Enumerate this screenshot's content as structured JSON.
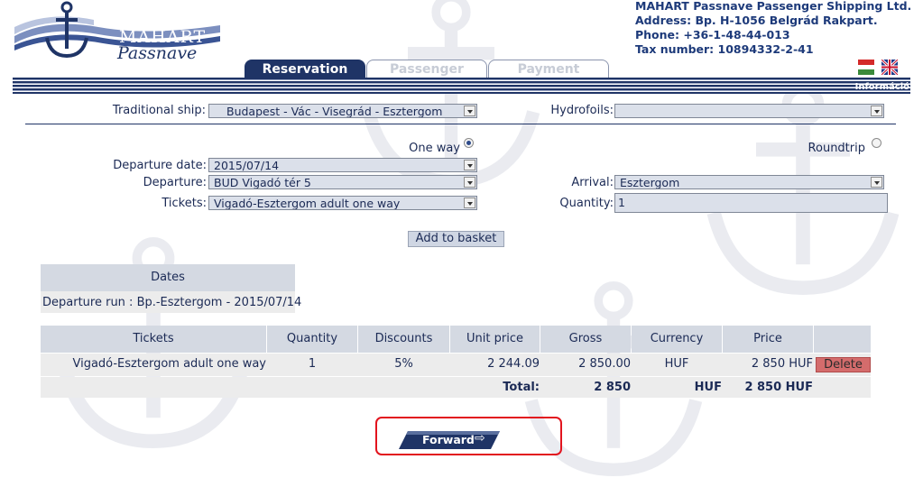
{
  "brand": {
    "logo_top": "MAHART",
    "logo_bottom": "Passnave"
  },
  "company": {
    "line1": "MAHART Passnave Passenger Shipping Ltd.",
    "line2": "Address: Bp. H-1056 Belgrád Rakpart.",
    "line3": "Phone: +36-1-48-44-013",
    "line4": "Tax number: 10894332-2-41"
  },
  "tabs": [
    {
      "label": "Reservation",
      "active": true
    },
    {
      "label": "Passenger",
      "active": false
    },
    {
      "label": "Payment",
      "active": false
    }
  ],
  "info_link": "Információ",
  "form": {
    "traditional_ship_label": "Traditional ship:",
    "traditional_ship_value": "Budapest - Vác - Visegrád - Esztergom",
    "hydrofoils_label": "Hydrofoils:",
    "hydrofoils_value": "",
    "one_way_label": "One way",
    "roundtrip_label": "Roundtrip",
    "departure_date_label": "Departure date:",
    "departure_date_value": "2015/07/14",
    "departure_label": "Departure:",
    "departure_value": "BUD Vigadó tér 5",
    "arrival_label": "Arrival:",
    "arrival_value": "Esztergom",
    "tickets_label": "Tickets:",
    "tickets_value": "Vigadó-Esztergom adult one way",
    "quantity_label": "Quantity:",
    "quantity_value": "1",
    "add_to_basket": "Add to basket"
  },
  "dates_table": {
    "header": "Dates",
    "row": "Departure run : Bp.-Esztergom - 2015/07/14"
  },
  "basket": {
    "headers": [
      "Tickets",
      "Quantity",
      "Discounts",
      "Unit price",
      "Gross",
      "Currency",
      "Price"
    ],
    "row": {
      "ticket": "Vigadó-Esztergom adult one way",
      "quantity": "1",
      "discount": "5%",
      "unit_price": "2 244.09",
      "gross": "2 850.00",
      "currency": "HUF",
      "price": "2 850 HUF"
    },
    "delete_label": "Delete",
    "total_label": "Total:",
    "total_gross": "2 850",
    "total_currency": "HUF",
    "total_price": "2 850 HUF"
  },
  "forward_label": "Forward",
  "colors": {
    "navy": "#1f3466",
    "header_gray": "#d4d9e2",
    "delete_red": "#d46c6c",
    "highlight": "#e2141e"
  }
}
